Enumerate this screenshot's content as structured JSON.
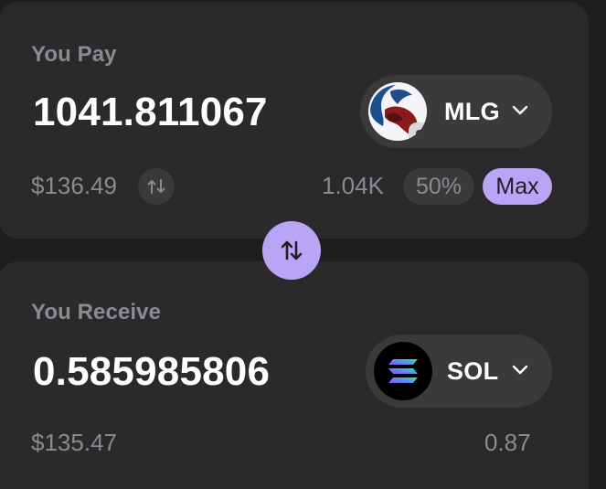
{
  "pay": {
    "label": "You Pay",
    "amount": "1041.811067",
    "token": {
      "symbol": "MLG",
      "logo_icon": "mlg-token-logo",
      "badge_icon": "token-standard-badge-icon"
    },
    "usd_value": "$136.49",
    "balance": "1.04K",
    "half_label": "50%",
    "max_label": "Max"
  },
  "receive": {
    "label": "You Receive",
    "amount": "0.585985806",
    "token": {
      "symbol": "SOL",
      "logo_icon": "solana-logo"
    },
    "usd_value": "$135.47",
    "balance": "0.87"
  },
  "colors": {
    "background": "#1e1e20",
    "card": "#2a2a2c",
    "pill": "#3a3a3d",
    "accent": "#b9a5f5",
    "muted_text": "#8b8b8f",
    "text": "#ffffff"
  },
  "icons": {
    "swap": "swap-arrows-icon",
    "refresh": "refresh-icon",
    "chevron": "chevron-down-icon"
  }
}
